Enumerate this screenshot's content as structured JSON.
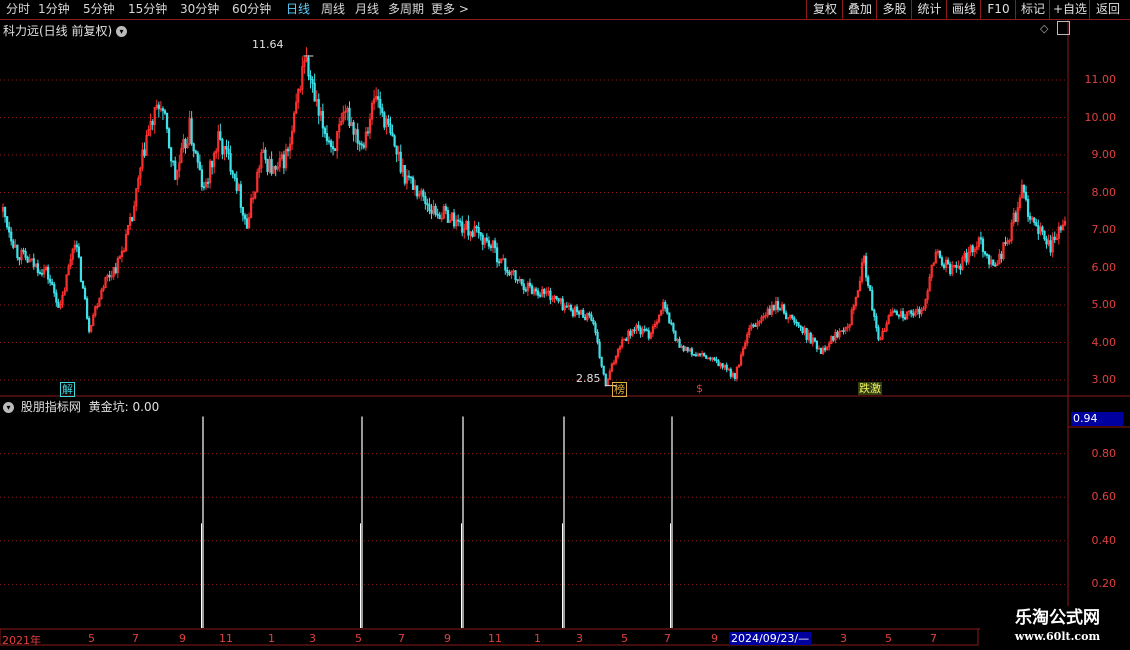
{
  "toolbar": {
    "tabs": [
      "分时",
      "1分钟",
      "5分钟",
      "15分钟",
      "30分钟",
      "60分钟",
      "日线",
      "周线",
      "月线",
      "多周期",
      "更多 >"
    ],
    "active_tab": "日线",
    "right_buttons": [
      "复权",
      "叠加",
      "多股",
      "统计",
      "画线",
      "F10",
      "标记",
      "+自选",
      "返回"
    ]
  },
  "main_panel": {
    "title": "科力远(日线 前复权)",
    "high_label": "11.64",
    "low_label": "2.85",
    "markers": [
      {
        "text": "解",
        "color": "#40d8e0"
      },
      {
        "text": "榜",
        "color": "#e0b040"
      },
      {
        "text": "$",
        "color": "#e04040"
      },
      {
        "text": "跌激",
        "color": "#f0f060"
      }
    ],
    "y_axis": [
      "11.00",
      "10.00",
      "9.00",
      "8.00",
      "7.00",
      "6.00",
      "5.00",
      "4.00",
      "3.00"
    ]
  },
  "indicator_panel": {
    "title": "股朋指标网",
    "indicator_label": "黄金坑: 0.00",
    "current_value": "0.94",
    "y_axis": [
      "0.80",
      "0.60",
      "0.40",
      "0.20"
    ]
  },
  "x_axis": {
    "labels": [
      "2021年",
      "5",
      "7",
      "9",
      "11",
      "1",
      "3",
      "5",
      "7",
      "9",
      "11",
      "1",
      "3",
      "5",
      "7",
      "9",
      "2024/09/23/—",
      "3",
      "5",
      "7"
    ]
  },
  "colors": {
    "up": "#ff3030",
    "down": "#40e0e8",
    "grid": "#8b1a1a",
    "axis": "#e04040"
  },
  "chart_data": {
    "type": "candlestick",
    "title": "科力远(日线 前复权)",
    "ylim": [
      2.6,
      12.2
    ],
    "y_ticks": [
      3,
      4,
      5,
      6,
      7,
      8,
      9,
      10,
      11
    ],
    "series": [
      {
        "values": [
          7.5,
          6.4,
          6.1,
          5.9,
          4.9,
          6.8,
          4.4,
          5.6,
          6.1,
          7.3,
          9.5,
          10.4,
          8.4,
          9.7,
          8.0,
          9.4,
          8.7,
          7.1,
          9.0,
          8.5,
          9.2,
          11.64,
          10.0,
          9.2,
          10.1,
          9.3,
          10.6,
          9.5,
          8.5,
          8.0,
          7.5,
          7.4,
          7.1,
          6.9,
          6.6,
          6.0,
          5.6,
          5.4,
          5.3,
          5.0,
          4.8,
          4.7,
          2.85,
          4.0,
          4.4,
          4.2,
          5.0,
          4.0,
          3.7,
          3.6,
          3.4,
          3.1,
          4.3,
          4.7,
          5.0,
          4.6,
          4.2,
          3.8,
          4.2,
          4.6,
          6.2,
          4.0,
          4.9,
          4.7,
          4.8,
          6.4,
          5.9,
          6.2,
          6.8,
          6.0,
          6.7,
          8.0,
          7.0,
          6.6,
          7.2
        ]
      }
    ],
    "indicator": {
      "name": "黄金坑",
      "ylim": [
        0,
        1
      ],
      "y_ticks": [
        0.2,
        0.4,
        0.6,
        0.8
      ],
      "spikes": [
        1,
        1,
        1,
        1,
        1
      ]
    }
  }
}
